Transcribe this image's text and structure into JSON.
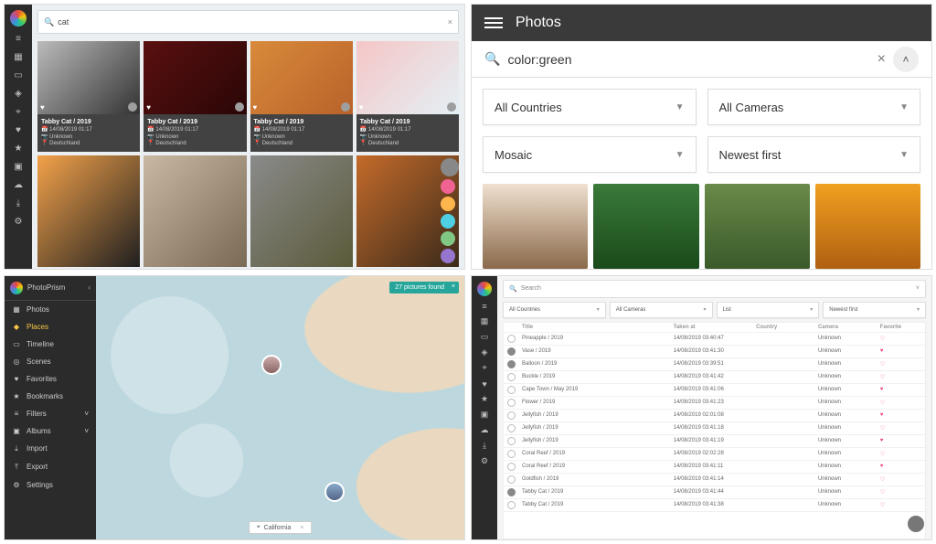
{
  "paneA": {
    "search": {
      "query": "cat"
    },
    "rail_icons": [
      "menu",
      "photo",
      "calendar",
      "tag",
      "place",
      "heart",
      "bookmark",
      "folder",
      "cloud",
      "download",
      "settings"
    ],
    "cards": [
      {
        "title": "Tabby Cat / 2019",
        "date": "14/08/2019 01:17",
        "owner": "Unknown",
        "place": "Deutschland"
      },
      {
        "title": "Tabby Cat / 2019",
        "date": "14/08/2019 01:17",
        "owner": "Unknown",
        "place": "Deutschland"
      },
      {
        "title": "Tabby Cat / 2019",
        "date": "14/08/2019 01:17",
        "owner": "Unknown",
        "place": "Deutschland"
      },
      {
        "title": "Tabby Cat / 2019",
        "date": "14/08/2019 01:17",
        "owner": "Unknown",
        "place": "Deutschland"
      }
    ],
    "fab_colors": [
      "#f06292",
      "#ffb74d",
      "#4dd0e1",
      "#81c784",
      "#9575cd"
    ]
  },
  "paneB": {
    "header_title": "Photos",
    "search_query": "color:green",
    "filters": {
      "country": "All Countries",
      "camera": "All Cameras",
      "view": "Mosaic",
      "sort": "Newest first"
    }
  },
  "paneC": {
    "app_name": "PhotoPrism",
    "menu": [
      {
        "icon": "▦",
        "label": "Photos"
      },
      {
        "icon": "◆",
        "label": "Places",
        "active": true
      },
      {
        "icon": "▭",
        "label": "Timeline"
      },
      {
        "icon": "◎",
        "label": "Scenes"
      },
      {
        "icon": "♥",
        "label": "Favorites"
      },
      {
        "icon": "★",
        "label": "Bookmarks"
      },
      {
        "icon": "≡",
        "label": "Filters",
        "chev": "˅"
      },
      {
        "icon": "▣",
        "label": "Albums",
        "chev": "˅"
      },
      {
        "icon": "⤓",
        "label": "Import"
      },
      {
        "icon": "⤒",
        "label": "Export"
      },
      {
        "icon": "⚙",
        "label": "Settings"
      }
    ],
    "chip": "27 pictures found",
    "location_label": "California"
  },
  "paneD": {
    "search_placeholder": "Search",
    "filters": {
      "country": "All Countries",
      "camera": "All Cameras",
      "view": "List",
      "sort": "Newest first"
    },
    "columns": [
      "",
      "Title",
      "Taken at",
      "Country",
      "Camera",
      "Favorite"
    ],
    "rows": [
      {
        "sel": false,
        "title": "Pineapple / 2019",
        "date": "14/08/2019 03:40:47",
        "country": "",
        "camera": "Unknown",
        "fav": false
      },
      {
        "sel": true,
        "title": "Vase / 2019",
        "date": "14/08/2019 03:41:30",
        "country": "",
        "camera": "Unknown",
        "fav": true
      },
      {
        "sel": true,
        "title": "Balloon / 2019",
        "date": "14/08/2019 03:39:51",
        "country": "",
        "camera": "Unknown",
        "fav": false
      },
      {
        "sel": false,
        "title": "Buckle / 2019",
        "date": "14/08/2019 03:41:42",
        "country": "",
        "camera": "Unknown",
        "fav": false
      },
      {
        "sel": false,
        "title": "Cape Town / May 2019",
        "date": "14/08/2019 03:41:06",
        "country": "",
        "camera": "Unknown",
        "fav": true
      },
      {
        "sel": false,
        "title": "Flower / 2019",
        "date": "14/08/2019 03:41:23",
        "country": "",
        "camera": "Unknown",
        "fav": false
      },
      {
        "sel": false,
        "title": "Jellyfish / 2019",
        "date": "14/08/2019 02:01:08",
        "country": "",
        "camera": "Unknown",
        "fav": true
      },
      {
        "sel": false,
        "title": "Jellyfish / 2019",
        "date": "14/08/2019 03:41:18",
        "country": "",
        "camera": "Unknown",
        "fav": false
      },
      {
        "sel": false,
        "title": "Jellyfish / 2019",
        "date": "14/08/2019 03:41:19",
        "country": "",
        "camera": "Unknown",
        "fav": true
      },
      {
        "sel": false,
        "title": "Coral Reef / 2019",
        "date": "14/08/2019 02:02:28",
        "country": "",
        "camera": "Unknown",
        "fav": false
      },
      {
        "sel": false,
        "title": "Coral Reef / 2019",
        "date": "14/08/2019 03:41:11",
        "country": "",
        "camera": "Unknown",
        "fav": true
      },
      {
        "sel": false,
        "title": "Goldfish / 2019",
        "date": "14/08/2019 03:41:14",
        "country": "",
        "camera": "Unknown",
        "fav": false
      },
      {
        "sel": true,
        "title": "Tabby Cat / 2019",
        "date": "14/08/2019 03:41:44",
        "country": "",
        "camera": "Unknown",
        "fav": false
      },
      {
        "sel": false,
        "title": "Tabby Cat / 2019",
        "date": "14/08/2019 03:41:38",
        "country": "",
        "camera": "Unknown",
        "fav": false
      }
    ]
  }
}
